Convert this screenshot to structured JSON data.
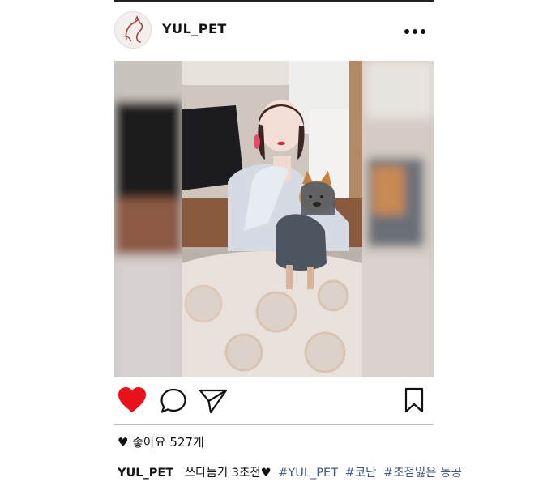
{
  "post": {
    "username": "YUL_PET",
    "likes_text": "좋아요 527개",
    "caption_user": "YUL_PET",
    "caption_text": "쓰다듬기 3초전♥",
    "hashtags": [
      "#YUL_PET",
      "#코난",
      "#초점잃은 동공"
    ]
  },
  "icons": {
    "avatar": "cat-logo-icon",
    "more": "more-dots-icon",
    "like": "heart-icon",
    "comment": "comment-icon",
    "share": "send-icon",
    "save": "bookmark-icon",
    "likes_prefix": "heart-small-icon"
  },
  "colors": {
    "like": "#e8121b",
    "hashtag": "#3f5a85"
  }
}
